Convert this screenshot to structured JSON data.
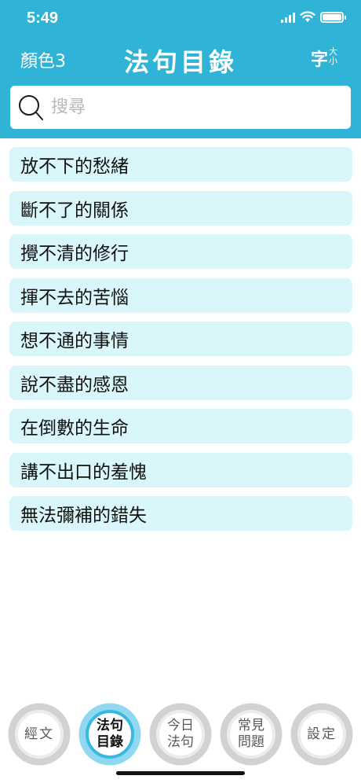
{
  "status_bar": {
    "time": "5:49"
  },
  "header": {
    "color_button": "顏色3",
    "title": "法句目錄",
    "font_size_button": {
      "main": "字",
      "sup1": "大",
      "sup2": "小"
    },
    "background": "#2fb3d6"
  },
  "search": {
    "placeholder": "搜尋",
    "value": ""
  },
  "list": {
    "items": [
      "放不下的愁緒",
      "斷不了的關係",
      "攪不清的修行",
      "揮不去的苦惱",
      "想不通的事情",
      "說不盡的感恩",
      "在倒數的生命",
      "講不出口的羞愧",
      "無法彌補的錯失"
    ]
  },
  "tabbar": {
    "tabs": [
      {
        "label": "經文",
        "active": false
      },
      {
        "label": "法句目錄",
        "active": true
      },
      {
        "label": "今日法句",
        "active": false
      },
      {
        "label": "常見問題",
        "active": false
      },
      {
        "label": "設定",
        "active": false
      }
    ],
    "active_color": "#3ab9e0"
  }
}
